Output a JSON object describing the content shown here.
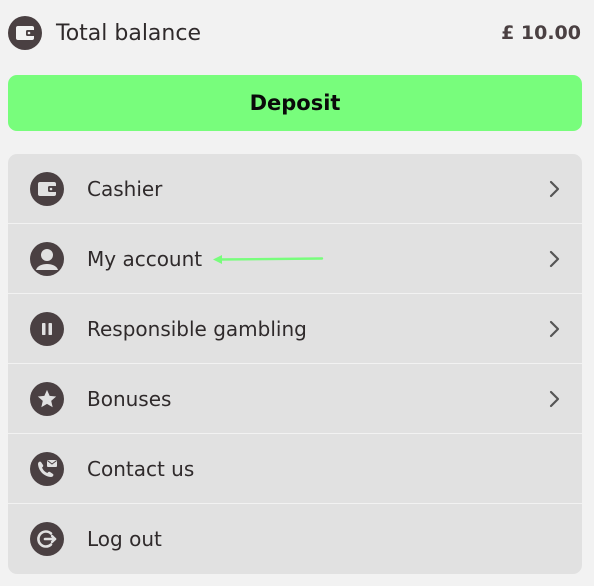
{
  "balance": {
    "label": "Total balance",
    "amount": "£ 10.00",
    "icon": "wallet-icon"
  },
  "deposit": {
    "label": "Deposit",
    "color": "#78fd7c"
  },
  "menu": {
    "items": [
      {
        "label": "Cashier",
        "icon": "wallet-icon",
        "has_chevron": true
      },
      {
        "label": "My account",
        "icon": "user-icon",
        "has_chevron": true
      },
      {
        "label": "Responsible gambling",
        "icon": "pause-icon",
        "has_chevron": true
      },
      {
        "label": "Bonuses",
        "icon": "star-icon",
        "has_chevron": true
      },
      {
        "label": "Contact us",
        "icon": "phone-mail-icon",
        "has_chevron": false
      },
      {
        "label": "Log out",
        "icon": "logout-icon",
        "has_chevron": false
      }
    ]
  },
  "colors": {
    "background": "#f2f2f2",
    "menu_background": "#e1e1e1",
    "icon_background": "#4a4042",
    "annotation_arrow": "#78fd7c"
  }
}
